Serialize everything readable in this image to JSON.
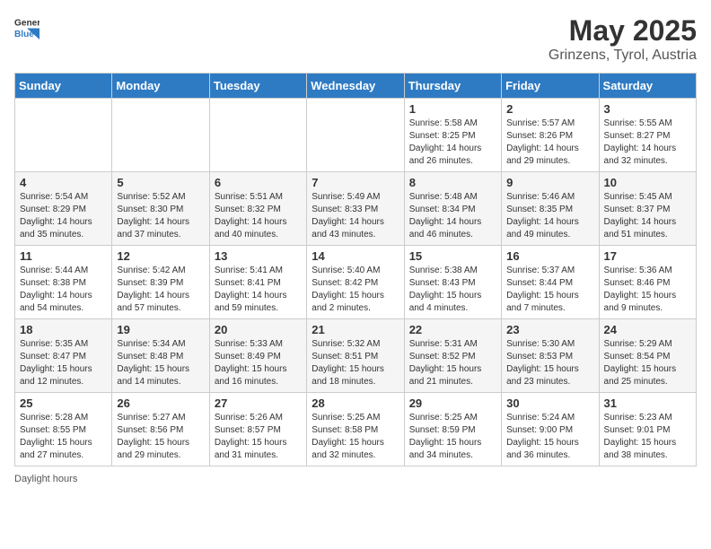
{
  "header": {
    "logo_general": "General",
    "logo_blue": "Blue",
    "month": "May 2025",
    "location": "Grinzens, Tyrol, Austria"
  },
  "days_of_week": [
    "Sunday",
    "Monday",
    "Tuesday",
    "Wednesday",
    "Thursday",
    "Friday",
    "Saturday"
  ],
  "weeks": [
    [
      {
        "day": "",
        "info": ""
      },
      {
        "day": "",
        "info": ""
      },
      {
        "day": "",
        "info": ""
      },
      {
        "day": "",
        "info": ""
      },
      {
        "day": "1",
        "info": "Sunrise: 5:58 AM\nSunset: 8:25 PM\nDaylight: 14 hours\nand 26 minutes."
      },
      {
        "day": "2",
        "info": "Sunrise: 5:57 AM\nSunset: 8:26 PM\nDaylight: 14 hours\nand 29 minutes."
      },
      {
        "day": "3",
        "info": "Sunrise: 5:55 AM\nSunset: 8:27 PM\nDaylight: 14 hours\nand 32 minutes."
      }
    ],
    [
      {
        "day": "4",
        "info": "Sunrise: 5:54 AM\nSunset: 8:29 PM\nDaylight: 14 hours\nand 35 minutes."
      },
      {
        "day": "5",
        "info": "Sunrise: 5:52 AM\nSunset: 8:30 PM\nDaylight: 14 hours\nand 37 minutes."
      },
      {
        "day": "6",
        "info": "Sunrise: 5:51 AM\nSunset: 8:32 PM\nDaylight: 14 hours\nand 40 minutes."
      },
      {
        "day": "7",
        "info": "Sunrise: 5:49 AM\nSunset: 8:33 PM\nDaylight: 14 hours\nand 43 minutes."
      },
      {
        "day": "8",
        "info": "Sunrise: 5:48 AM\nSunset: 8:34 PM\nDaylight: 14 hours\nand 46 minutes."
      },
      {
        "day": "9",
        "info": "Sunrise: 5:46 AM\nSunset: 8:35 PM\nDaylight: 14 hours\nand 49 minutes."
      },
      {
        "day": "10",
        "info": "Sunrise: 5:45 AM\nSunset: 8:37 PM\nDaylight: 14 hours\nand 51 minutes."
      }
    ],
    [
      {
        "day": "11",
        "info": "Sunrise: 5:44 AM\nSunset: 8:38 PM\nDaylight: 14 hours\nand 54 minutes."
      },
      {
        "day": "12",
        "info": "Sunrise: 5:42 AM\nSunset: 8:39 PM\nDaylight: 14 hours\nand 57 minutes."
      },
      {
        "day": "13",
        "info": "Sunrise: 5:41 AM\nSunset: 8:41 PM\nDaylight: 14 hours\nand 59 minutes."
      },
      {
        "day": "14",
        "info": "Sunrise: 5:40 AM\nSunset: 8:42 PM\nDaylight: 15 hours\nand 2 minutes."
      },
      {
        "day": "15",
        "info": "Sunrise: 5:38 AM\nSunset: 8:43 PM\nDaylight: 15 hours\nand 4 minutes."
      },
      {
        "day": "16",
        "info": "Sunrise: 5:37 AM\nSunset: 8:44 PM\nDaylight: 15 hours\nand 7 minutes."
      },
      {
        "day": "17",
        "info": "Sunrise: 5:36 AM\nSunset: 8:46 PM\nDaylight: 15 hours\nand 9 minutes."
      }
    ],
    [
      {
        "day": "18",
        "info": "Sunrise: 5:35 AM\nSunset: 8:47 PM\nDaylight: 15 hours\nand 12 minutes."
      },
      {
        "day": "19",
        "info": "Sunrise: 5:34 AM\nSunset: 8:48 PM\nDaylight: 15 hours\nand 14 minutes."
      },
      {
        "day": "20",
        "info": "Sunrise: 5:33 AM\nSunset: 8:49 PM\nDaylight: 15 hours\nand 16 minutes."
      },
      {
        "day": "21",
        "info": "Sunrise: 5:32 AM\nSunset: 8:51 PM\nDaylight: 15 hours\nand 18 minutes."
      },
      {
        "day": "22",
        "info": "Sunrise: 5:31 AM\nSunset: 8:52 PM\nDaylight: 15 hours\nand 21 minutes."
      },
      {
        "day": "23",
        "info": "Sunrise: 5:30 AM\nSunset: 8:53 PM\nDaylight: 15 hours\nand 23 minutes."
      },
      {
        "day": "24",
        "info": "Sunrise: 5:29 AM\nSunset: 8:54 PM\nDaylight: 15 hours\nand 25 minutes."
      }
    ],
    [
      {
        "day": "25",
        "info": "Sunrise: 5:28 AM\nSunset: 8:55 PM\nDaylight: 15 hours\nand 27 minutes."
      },
      {
        "day": "26",
        "info": "Sunrise: 5:27 AM\nSunset: 8:56 PM\nDaylight: 15 hours\nand 29 minutes."
      },
      {
        "day": "27",
        "info": "Sunrise: 5:26 AM\nSunset: 8:57 PM\nDaylight: 15 hours\nand 31 minutes."
      },
      {
        "day": "28",
        "info": "Sunrise: 5:25 AM\nSunset: 8:58 PM\nDaylight: 15 hours\nand 32 minutes."
      },
      {
        "day": "29",
        "info": "Sunrise: 5:25 AM\nSunset: 8:59 PM\nDaylight: 15 hours\nand 34 minutes."
      },
      {
        "day": "30",
        "info": "Sunrise: 5:24 AM\nSunset: 9:00 PM\nDaylight: 15 hours\nand 36 minutes."
      },
      {
        "day": "31",
        "info": "Sunrise: 5:23 AM\nSunset: 9:01 PM\nDaylight: 15 hours\nand 38 minutes."
      }
    ]
  ],
  "footer": {
    "label": "Daylight hours"
  }
}
